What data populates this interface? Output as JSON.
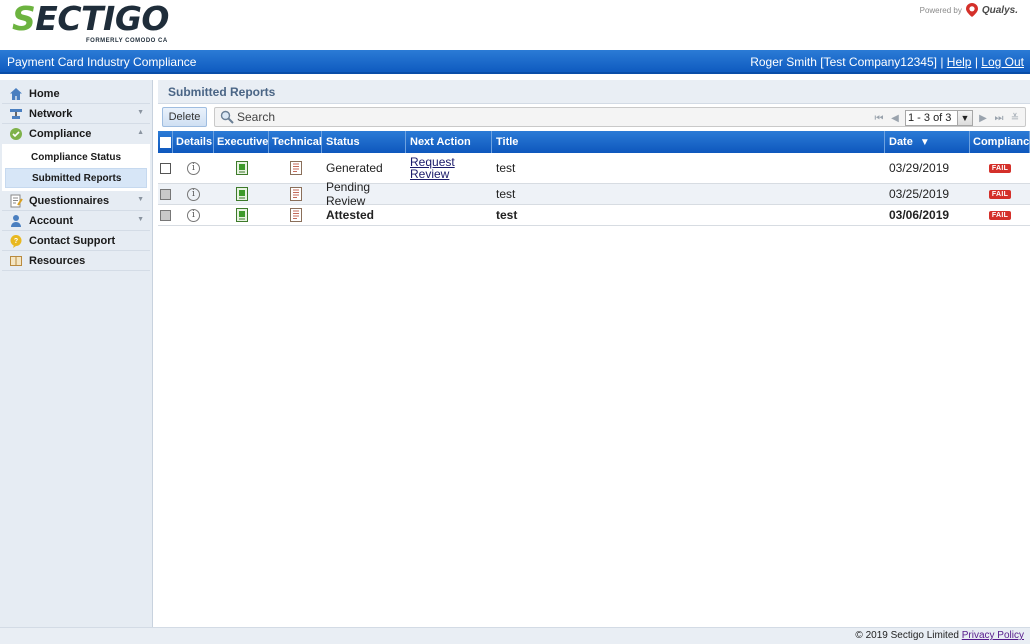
{
  "brand": {
    "logo_text": "SECTIGO",
    "logo_sub": "FORMERLY COMODO CA",
    "powered_by": "Powered by",
    "partner": "Qualys."
  },
  "header": {
    "app_title": "Payment Card Industry Compliance",
    "user": "Roger Smith [Test Company12345]",
    "separator": "|",
    "help": "Help",
    "logout": "Log Out"
  },
  "sidebar": {
    "items": [
      {
        "label": "Home",
        "icon": "home-icon"
      },
      {
        "label": "Network",
        "icon": "network-icon"
      },
      {
        "label": "Compliance",
        "icon": "compliance-icon"
      },
      {
        "label": "Questionnaires",
        "icon": "questionnaire-icon"
      },
      {
        "label": "Account",
        "icon": "account-icon"
      },
      {
        "label": "Contact Support",
        "icon": "support-icon"
      },
      {
        "label": "Resources",
        "icon": "resources-icon"
      }
    ],
    "compliance_sub": [
      {
        "label": "Compliance Status"
      },
      {
        "label": "Submitted Reports"
      }
    ]
  },
  "main": {
    "title": "Submitted Reports",
    "toolbar": {
      "delete_label": "Delete",
      "search_label": "Search",
      "pager_text": "1 - 3 of 3"
    },
    "table": {
      "columns": [
        "Details",
        "Executive",
        "Technical",
        "Status",
        "Next Action",
        "Title",
        "Date",
        "Compliance"
      ],
      "rows": [
        {
          "status": "Generated",
          "next_action_1": "Request",
          "next_action_2": "Review",
          "title": "test",
          "date": "03/29/2019",
          "compliance": "FAIL"
        },
        {
          "status": "Pending Review",
          "next_action_1": "",
          "next_action_2": "",
          "title": "test",
          "date": "03/25/2019",
          "compliance": "FAIL"
        },
        {
          "status": "Attested",
          "next_action_1": "",
          "next_action_2": "",
          "title": "test",
          "date": "03/06/2019",
          "compliance": "FAIL"
        }
      ]
    }
  },
  "footer": {
    "copyright": "© 2019 Sectigo Limited",
    "privacy": "Privacy Policy"
  },
  "colors": {
    "header_blue": "#1565c8",
    "fail_red": "#d4302a",
    "sidebar_bg": "#e6ecf3"
  }
}
